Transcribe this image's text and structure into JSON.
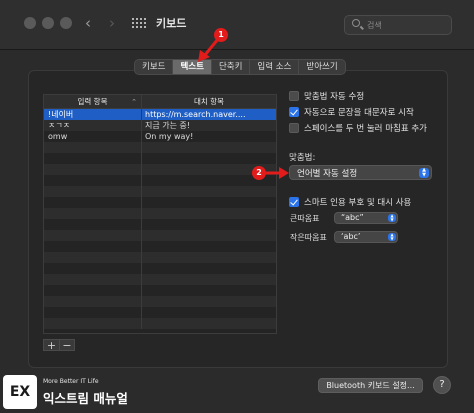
{
  "window": {
    "title": "키보드"
  },
  "search": {
    "placeholder": "검색"
  },
  "tabs": [
    {
      "label": "키보드",
      "active": false
    },
    {
      "label": "텍스트",
      "active": true
    },
    {
      "label": "단축키",
      "active": false
    },
    {
      "label": "입력 소스",
      "active": false
    },
    {
      "label": "받아쓰기",
      "active": false
    }
  ],
  "table": {
    "col_replace": "입력 항목",
    "col_with": "대치 항목",
    "rows": [
      {
        "replace": "!네이버",
        "with": "https://m.search.naver....",
        "selected": true
      },
      {
        "replace": "ㅈㄱㅈ",
        "with": "지금 가는 중!",
        "selected": false
      },
      {
        "replace": "omw",
        "with": "On my way!",
        "selected": false
      }
    ]
  },
  "options": {
    "autocorrect": {
      "label": "맞춤법 자동 수정",
      "checked": false
    },
    "capitalize": {
      "label": "자동으로 문장을 대문자로 시작",
      "checked": true
    },
    "period": {
      "label": "스페이스를 두 번 눌러 마침표 추가",
      "checked": false
    },
    "spelling_label": "맞춤법:",
    "spelling_value": "언어별 자동 설정",
    "smart_quotes": {
      "label": "스마트 인용 부호 및 대시 사용",
      "checked": true
    },
    "double_label": "큰따옴표",
    "double_value": "“abc”",
    "single_label": "작은따옴표",
    "single_value": "‘abc’"
  },
  "bottom": {
    "bluetooth_label": "Bluetooth 키보드 설정...",
    "help_label": "?"
  },
  "annotations": {
    "badge1": "1",
    "badge2": "2"
  },
  "watermark": {
    "tagline": "More Better IT Life",
    "name": "익스트림 매뉴얼",
    "mark": "EX"
  },
  "colors": {
    "accent": "#2b73e8",
    "selection": "#1f5ec4",
    "annotation": "#e21b1b"
  }
}
